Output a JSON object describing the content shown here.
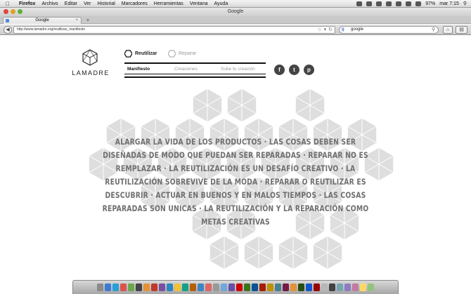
{
  "menubar": {
    "app": "Firefox",
    "items": [
      "Archivo",
      "Editar",
      "Ver",
      "Historial",
      "Marcadores",
      "Herramientas",
      "Ventana",
      "Ayuda"
    ],
    "battery": "97%",
    "clock": "mar 7:15"
  },
  "window": {
    "title": "Google"
  },
  "tabs": [
    {
      "label": "Google"
    }
  ],
  "navbar": {
    "url": "http://www.lamadre.org/reutilizar_manifiesto",
    "search_value": "google"
  },
  "site": {
    "logo": "LAMADRE",
    "categories": [
      {
        "label": "Reutilizar",
        "active": true
      },
      {
        "label": "Reparar",
        "active": false
      }
    ],
    "subnav": [
      {
        "label": "Manifiesto",
        "active": true
      },
      {
        "label": "Creaciones",
        "active": false
      },
      {
        "label": "Sube tu creación",
        "active": false
      }
    ],
    "social": [
      {
        "icon": "facebook-icon",
        "glyph": "f"
      },
      {
        "icon": "twitter-icon",
        "glyph": "t"
      },
      {
        "icon": "pinterest-icon",
        "glyph": "p"
      }
    ],
    "manifesto": "ALARGAR LA VIDA DE LOS PRODUCTOS · LAS COSAS DEBEN SER DISEÑADAS DE MODO QUE PUEDAN SER REPARADAS · REPARAR NO ES REMPLAZAR ·  LA REUTILIZACIÓN ES UN DESAFÍO CREATIVO · LA REUTILIZACIÓN SOBREVIVE DE LA MODA · REPARAR O REUTILIZAR ES DESCUBRIR · ACTUAR EN BUENOS Y EN MALOS TIEMPOS · LAS COSAS REPARADAS SON UNICAS · LA REUTILIZACIÓN Y LA REPARACIÓN COMO METAS CREATIVAS"
  },
  "colors": {
    "hex_pattern": "#dedede",
    "manifesto_text": "#6f6f6f",
    "close_button": "#e0443e",
    "minimize_button": "#dea123",
    "zoom_button": "#5db13a"
  }
}
